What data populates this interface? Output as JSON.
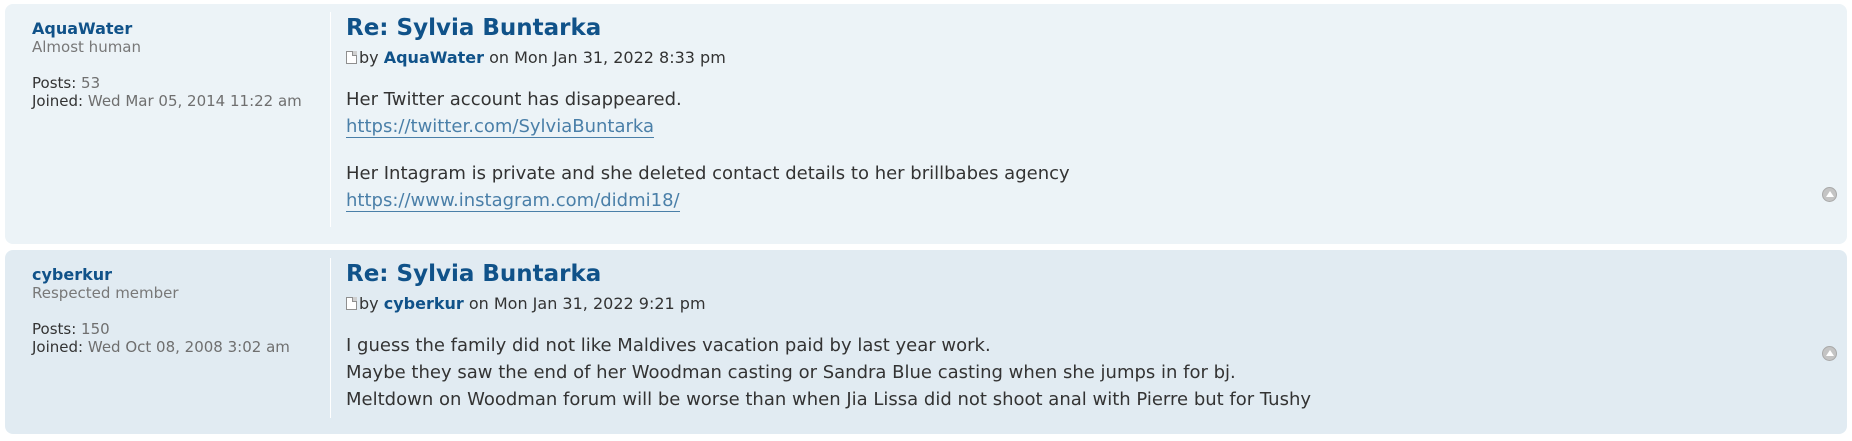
{
  "posts": [
    {
      "author": "AquaWater",
      "rank": "Almost human",
      "posts_label": "Posts:",
      "posts_count": "53",
      "joined_label": "Joined:",
      "joined_date": "Wed Mar 05, 2014 11:22 am",
      "title": "Re: Sylvia Buntarka",
      "by": "by",
      "on_date": "on Mon Jan 31, 2022 8:33 pm",
      "lines": [
        "Her Twitter account has disappeared.",
        "https://twitter.com/SylviaBuntarka",
        "Her Intagram is private and she deleted contact details to her brillbabes agency",
        "https://www.instagram.com/didmi18/"
      ]
    },
    {
      "author": "cyberkur",
      "rank": "Respected member",
      "posts_label": "Posts:",
      "posts_count": "150",
      "joined_label": "Joined:",
      "joined_date": "Wed Oct 08, 2008 3:02 am",
      "title": "Re: Sylvia Buntarka",
      "by": "by",
      "on_date": "on Mon Jan 31, 2022 9:21 pm",
      "lines": [
        "I guess the family did not like Maldives vacation paid by last year work.",
        "Maybe they saw the end of her Woodman casting or Sandra Blue casting when she jumps in for bj.",
        "Meltdown on Woodman forum will be worse than when Jia Lissa did not shoot anal with Pierre but for Tushy"
      ]
    }
  ],
  "icons": {
    "post": "post-icon",
    "top": "back-to-top-icon"
  }
}
